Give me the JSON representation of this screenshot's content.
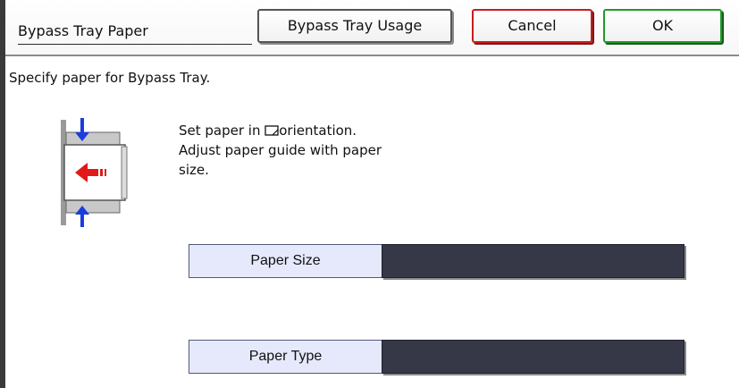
{
  "header": {
    "title": "Bypass Tray Paper",
    "usage_button": "Bypass Tray Usage",
    "cancel_button": "Cancel",
    "ok_button": "OK"
  },
  "instruction": "Specify paper for Bypass Tray.",
  "message": {
    "line1_before": "Set paper in ",
    "line1_after": "orientation.",
    "line2": "Adjust paper guide with paper",
    "line3": "size."
  },
  "fields": {
    "paper_size": {
      "label": "Paper Size",
      "value": ""
    },
    "paper_type": {
      "label": "Paper Type",
      "value": ""
    }
  },
  "icons": {
    "tray": "bypass-tray-icon",
    "orientation": "landscape-orientation-icon"
  },
  "colors": {
    "cancel_border": "#c81d1d",
    "ok_border": "#1f9a2a",
    "field_label_bg": "#e6e9fb",
    "field_value_bg": "#363848",
    "arrow_blue": "#1a3de0",
    "arrow_red": "#e01a1a"
  }
}
